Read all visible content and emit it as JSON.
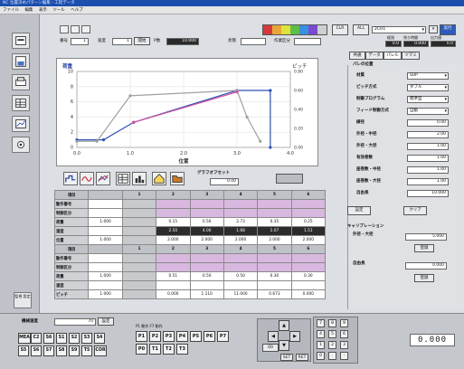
{
  "titlebar": {
    "text": "NC 位置決めパターン編集 - 工程データ"
  },
  "menubar": {
    "items": [
      "ファイル",
      "編集",
      "表示",
      "ツール",
      "ヘルプ"
    ]
  },
  "header": {
    "field1_label": "番号",
    "field1_value": "1",
    "field2_label": "速度",
    "field2_value": "1",
    "btn_a": "開始",
    "field3_label": "P数",
    "field3_value": "10.000",
    "field4_label": "状態",
    "mode_label": "作業区分",
    "color_swatches": [
      "#d43a3a",
      "#e8a63a",
      "#e0e23a",
      "#5cbf4a",
      "#3a8fe0",
      "#7a4ad0",
      "#cfcfcf"
    ],
    "swatch_btn": "CLR",
    "all_btn": "ALL",
    "combo_value": "2CH1",
    "top_right_btn": "実行",
    "readout_labels": [
      "経過",
      "残り時間",
      "出力値"
    ],
    "readout_values": [
      "0.0",
      "0.000",
      "0.0"
    ]
  },
  "chart_data": {
    "type": "line",
    "ylabel": "荷重",
    "y2label": "ピッチ",
    "xlabel": "位置",
    "xlim": [
      0,
      3.2
    ],
    "ylim": [
      0,
      10
    ],
    "y2lim": [
      0,
      0.8
    ],
    "xticks": [
      "0.0",
      "1.0",
      "2.0",
      "3.0",
      "4.0"
    ],
    "yticks": [
      "0",
      "2",
      "4",
      "6",
      "8",
      "10"
    ],
    "y2ticks": [
      "0.00",
      "0.20",
      "0.40",
      "0.60",
      "0.80"
    ],
    "series": [
      {
        "color": "#2c4fb5",
        "x": [
          0,
          0.4,
          0.85,
          2.4,
          2.9,
          2.9
        ],
        "y": [
          1.0,
          1.0,
          3.3,
          7.5,
          7.5,
          0.0
        ]
      },
      {
        "color": "#a0a0a0",
        "x": [
          0,
          0.3,
          0.8,
          2.4,
          2.55,
          2.75
        ],
        "y": [
          0.8,
          0.8,
          6.8,
          7.5,
          4.0,
          0.8
        ]
      },
      {
        "color": "#d04fa0",
        "x": [
          0.85,
          2.4
        ],
        "y": [
          3.3,
          7.3
        ]
      }
    ]
  },
  "toolbar2": {
    "offset_label": "グラフオフセット",
    "offset_value": "0.00"
  },
  "table1": {
    "headers": [
      "項目",
      "",
      "1",
      "2",
      "3",
      "4",
      "5",
      "6"
    ],
    "rows": [
      {
        "label": "動作番号",
        "cells": [
          "",
          "",
          "",
          "",
          "",
          "",
          "",
          ""
        ]
      },
      {
        "label": "制御区分",
        "cells": [
          "",
          "",
          "",
          "",
          "",
          "",
          "",
          ""
        ]
      },
      {
        "label": "荷重",
        "cells": [
          "1.000",
          "",
          "0.15",
          "0.56",
          "2.73",
          "0.35",
          "0.25",
          "0.25"
        ]
      },
      {
        "label": "速度",
        "cells": [
          "",
          "",
          "2.50",
          "4.00",
          "1.68",
          "1.07",
          "1.51",
          "1.23"
        ]
      },
      {
        "label": "位置",
        "cells": [
          "1.000",
          "",
          "2.000",
          "2.000",
          "2.000",
          "2.000",
          "2.000",
          "2.000"
        ]
      }
    ]
  },
  "table2": {
    "headers": [
      "項目",
      "",
      "1",
      "2",
      "3",
      "4",
      "5",
      "6"
    ],
    "rows": [
      {
        "label": "動作番号",
        "cells": [
          "",
          "",
          "",
          "",
          "",
          "",
          "",
          ""
        ]
      },
      {
        "label": "制御区分",
        "cells": [
          "",
          "",
          "",
          "",
          "",
          "",
          "",
          ""
        ]
      },
      {
        "label": "荷重",
        "cells": [
          "1.000",
          "",
          "0.51",
          "0.50",
          "0.50",
          "0.30",
          "0.30",
          "0.30"
        ]
      },
      {
        "label": "速度",
        "cells": [
          "",
          "",
          "",
          "",
          "",
          "",
          "",
          ""
        ]
      },
      {
        "label": "ピッチ",
        "cells": [
          "1.000",
          "",
          "0.000",
          "1.110",
          "11.000",
          "0.673",
          "0.000",
          "0.000"
        ]
      }
    ]
  },
  "rightpanel": {
    "tabs": [
      "共通",
      "データ",
      "パレル",
      "ツマミ"
    ],
    "section1": "パレの位置",
    "rows": [
      {
        "label": "材質",
        "value": "SUP",
        "kind": "select"
      },
      {
        "label": "ピッチ方式",
        "value": "ダブル",
        "kind": "select"
      },
      {
        "label": "制御プログラム",
        "value": "標準型",
        "kind": "select"
      },
      {
        "label": "フィード制御方式",
        "value": "自動",
        "kind": "select"
      },
      {
        "label": "線径",
        "value": "0.00",
        "kind": "field"
      },
      {
        "label": "外径・中径",
        "value": "2.00",
        "kind": "field"
      },
      {
        "label": "外径・大径",
        "value": "1.00",
        "kind": "field"
      },
      {
        "label": "有効巻数",
        "value": "1.00",
        "kind": "field"
      },
      {
        "label": "座巻数・中径",
        "value": "1.00",
        "kind": "field"
      },
      {
        "label": "座巻数・大径",
        "value": "1.00",
        "kind": "field"
      },
      {
        "label": "自由長",
        "value": "10.000",
        "kind": "field"
      }
    ],
    "btn_confirm": "設定",
    "btn_clear": "クリア",
    "section2": "キャリブレーション",
    "calib_label": "外径・大径",
    "calib_value": "5.000",
    "calib_btn": "登録",
    "free_label": "自由長",
    "free_value": "0.000",
    "free_btn": "登録"
  },
  "bottom": {
    "speed_label": "機械速度",
    "speed_value": "70",
    "speed_btn": "設定",
    "group_label": "P1 動作 F7 動作",
    "keys_row1": [
      "MEA",
      "C2",
      "S6",
      "S1",
      "S2",
      "S3",
      "S4"
    ],
    "keys_row2": [
      "S5",
      "S6",
      "S7",
      "S8",
      "S9",
      "T5",
      "COR"
    ],
    "fkeys_row1": [
      "P1",
      "P2",
      "P3",
      "P4",
      "P5",
      "P6",
      "P7"
    ],
    "fkeys_row2": [
      "P0",
      "T1",
      "T2",
      "T3"
    ],
    "arrow_mid": "00",
    "btn_set": "SET",
    "btn_ret": "RET",
    "numpad": [
      "7",
      "8",
      "9",
      "4",
      "5",
      "6",
      "1",
      "2",
      "3",
      "0",
      ".",
      "-"
    ],
    "display": "0.000"
  },
  "sidebar_bottom_label": "監視 設定"
}
